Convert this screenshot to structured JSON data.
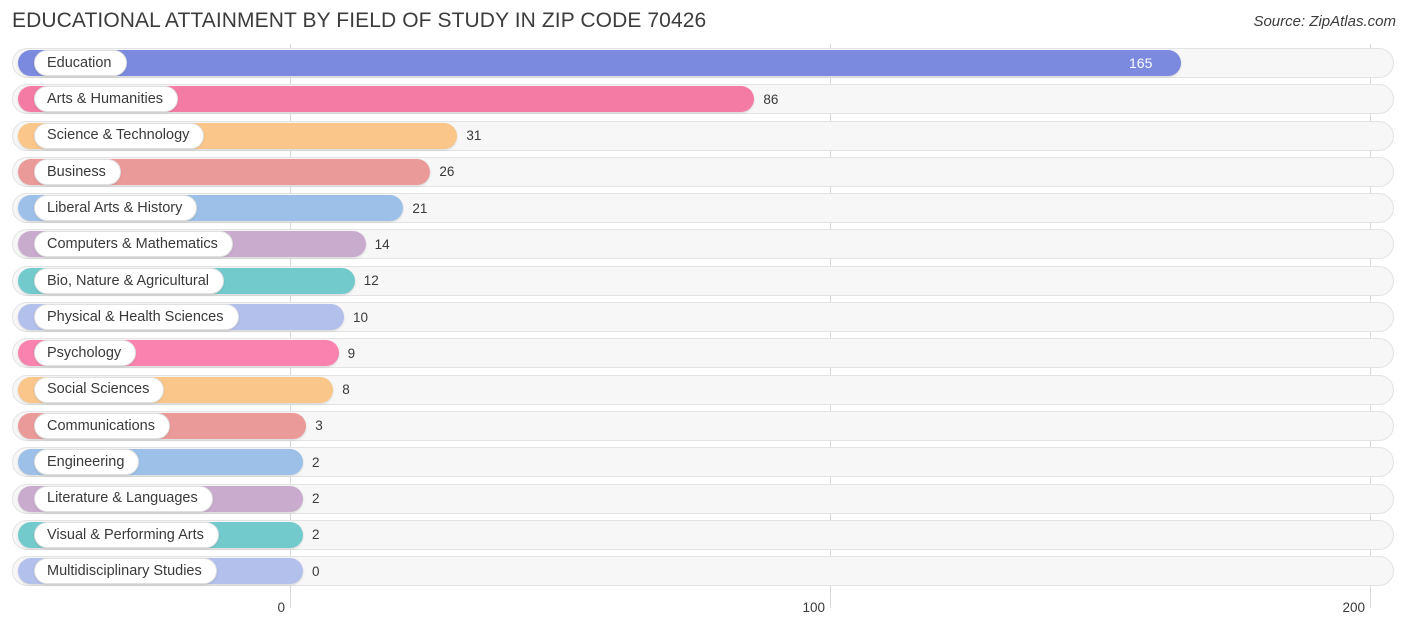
{
  "header": {
    "title": "EDUCATIONAL ATTAINMENT BY FIELD OF STUDY IN ZIP CODE 70426",
    "source": "Source: ZipAtlas.com"
  },
  "chart_data": {
    "type": "bar",
    "orientation": "horizontal",
    "title": "EDUCATIONAL ATTAINMENT BY FIELD OF STUDY IN ZIP CODE 70426",
    "xlabel": "",
    "ylabel": "",
    "xlim": [
      0,
      200
    ],
    "ticks": [
      "0",
      "100",
      "200"
    ],
    "tick_values": [
      0,
      100,
      200
    ],
    "grid": true,
    "legend": false,
    "categories": [
      "Education",
      "Arts & Humanities",
      "Science & Technology",
      "Business",
      "Liberal Arts & History",
      "Computers & Mathematics",
      "Bio, Nature & Agricultural",
      "Physical & Health Sciences",
      "Psychology",
      "Social Sciences",
      "Communications",
      "Engineering",
      "Literature & Languages",
      "Visual & Performing Arts",
      "Multidisciplinary Studies"
    ],
    "values": [
      165,
      86,
      31,
      26,
      21,
      14,
      12,
      10,
      9,
      8,
      3,
      2,
      2,
      2,
      0
    ],
    "value_labels": [
      "165",
      "86",
      "31",
      "26",
      "21",
      "14",
      "12",
      "10",
      "9",
      "8",
      "3",
      "2",
      "2",
      "2",
      "0"
    ],
    "colors": [
      "#7b8ade",
      "#f47ba4",
      "#fac68a",
      "#eb9a9a",
      "#9dc0e8",
      "#c9abce",
      "#73cacd",
      "#b4c0ec",
      "#f983ae",
      "#fac68a",
      "#eb9a9a",
      "#9dc0e8",
      "#c9abce",
      "#73cacd",
      "#b4c0ec"
    ]
  }
}
